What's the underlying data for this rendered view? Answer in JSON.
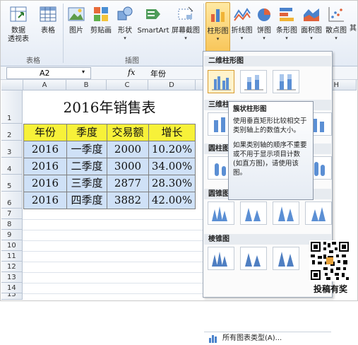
{
  "ribbon": {
    "buttons": [
      {
        "label": "数据",
        "label2": "透视表",
        "icon": "pivot-table-icon"
      },
      {
        "label": "表格",
        "icon": "table-icon"
      },
      {
        "label": "图片",
        "icon": "picture-icon"
      },
      {
        "label": "剪贴画",
        "icon": "clip-art-icon"
      },
      {
        "label": "形状",
        "icon": "shapes-icon"
      },
      {
        "label": "SmartArt",
        "icon": "smartart-icon"
      },
      {
        "label": "屏幕截图",
        "icon": "screenshot-icon"
      },
      {
        "label": "柱形图",
        "icon": "column-chart-icon"
      },
      {
        "label": "折线图",
        "icon": "line-chart-icon"
      },
      {
        "label": "饼图",
        "icon": "pie-chart-icon"
      },
      {
        "label": "条形图",
        "icon": "bar-chart-icon"
      },
      {
        "label": "面积图",
        "icon": "area-chart-icon"
      },
      {
        "label": "散点图",
        "icon": "scatter-chart-icon"
      },
      {
        "label": "其"
      }
    ],
    "group_labels": [
      "表格",
      "插图"
    ]
  },
  "formula_bar": {
    "name_box": "A2",
    "fx": "fx",
    "content": "年份"
  },
  "sheet": {
    "columns": [
      "A",
      "B",
      "C",
      "D",
      "H"
    ],
    "rows": [
      "1",
      "2",
      "3",
      "4",
      "5",
      "6",
      "7",
      "8",
      "9",
      "10",
      "11",
      "12",
      "13",
      "14",
      "15"
    ],
    "title": "2016年销售表",
    "header": [
      "年份",
      "季度",
      "交易额",
      "增长"
    ],
    "data": [
      [
        "2016",
        "一季度",
        "2000",
        "10.20%"
      ],
      [
        "2016",
        "二季度",
        "3000",
        "34.00%"
      ],
      [
        "2016",
        "三季度",
        "2877",
        "28.30%"
      ],
      [
        "2016",
        "四季度",
        "3882",
        "42.00%"
      ]
    ]
  },
  "gallery": {
    "sections": [
      "二维柱形图",
      "三维柱",
      "圆柱图",
      "圆锥图",
      "棱锥图"
    ],
    "all_charts": "所有图表类型(A)..."
  },
  "tooltip": {
    "title": "簇状柱形图",
    "text1": "使用垂直矩形比较相交于类别轴上的数值大小。",
    "text2": "如果类别轴的顺序不重要或不用于显示项目计数(如直方图)，请使用该图。"
  },
  "watermark": {
    "caption": "投稿有奖"
  },
  "colors": {
    "header_fill": "#f7f139",
    "data_fill": "#cfe1f7",
    "selected_button": "#f8c65a"
  }
}
